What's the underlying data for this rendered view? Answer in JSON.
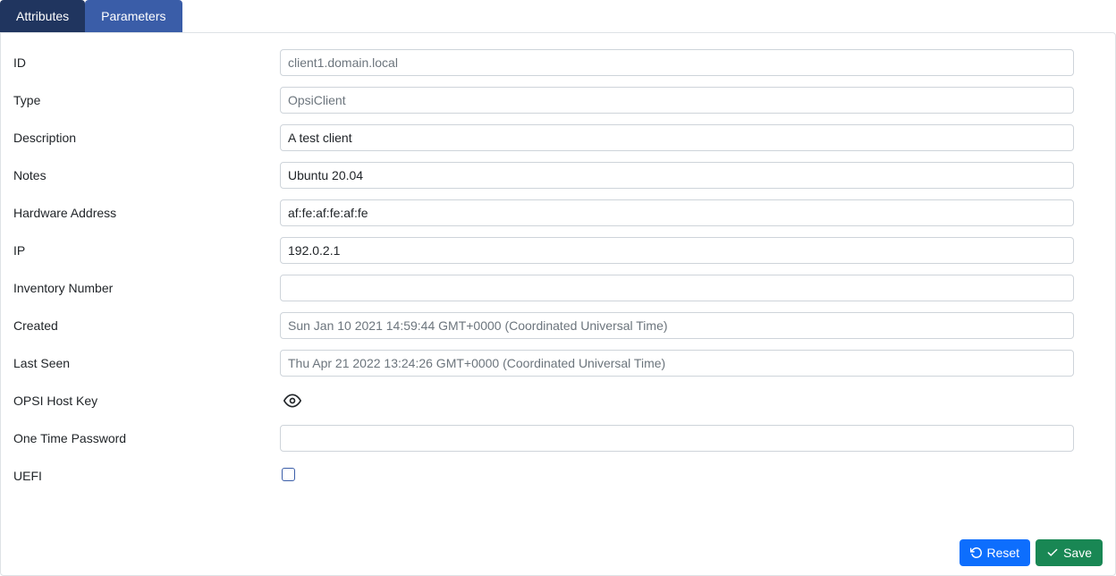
{
  "tabs": {
    "attributes": "Attributes",
    "parameters": "Parameters"
  },
  "labels": {
    "id": "ID",
    "type": "Type",
    "description": "Description",
    "notes": "Notes",
    "hardware_address": "Hardware Address",
    "ip": "IP",
    "inventory_number": "Inventory Number",
    "created": "Created",
    "last_seen": "Last Seen",
    "opsi_host_key": "OPSI Host Key",
    "one_time_password": "One Time Password",
    "uefi": "UEFI"
  },
  "values": {
    "id": "client1.domain.local",
    "type": "OpsiClient",
    "description": "A test client",
    "notes": "Ubuntu 20.04",
    "hardware_address": "af:fe:af:fe:af:fe",
    "ip": "192.0.2.1",
    "inventory_number": "",
    "created": "Sun Jan 10 2021 14:59:44 GMT+0000 (Coordinated Universal Time)",
    "last_seen": "Thu Apr 21 2022 13:24:26 GMT+0000 (Coordinated Universal Time)",
    "one_time_password": "",
    "uefi": false
  },
  "buttons": {
    "reset": "Reset",
    "save": "Save"
  }
}
